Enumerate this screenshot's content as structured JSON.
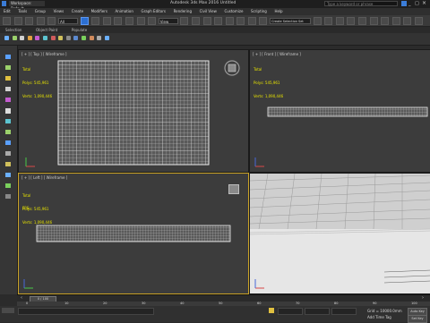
{
  "app": {
    "workspace": "Workspace: Default",
    "title": "Autodesk 3ds Max 2016    Untitled",
    "search_placeholder": "Type a keyword or phrase"
  },
  "menus": [
    "Edit",
    "Tools",
    "Group",
    "Views",
    "Create",
    "Modifiers",
    "Animation",
    "Graph Editors",
    "Rendering",
    "Civil View",
    "Customize",
    "Scripting",
    "Help"
  ],
  "toolbar": {
    "filter_value": "All",
    "view_value": "View",
    "selection_set": "Create Selection Set"
  },
  "ribbon": [
    "Selection",
    "Object Paint",
    "Populate"
  ],
  "viewports": {
    "top": {
      "label": "[ + ] [ Top ] [ Wireframe ]"
    },
    "front": {
      "label": "[ + ] [ Front ] [ Wireframe ]"
    },
    "left": {
      "label": "[ + ] [ Left ] [ Wireframe ]"
    },
    "persp": {
      "label": ""
    }
  },
  "stats": {
    "total": "Total",
    "polys_label": "Polys:",
    "polys": "545,961",
    "verts_label": "Verts:",
    "verts": "1,090,446",
    "fps": "FPS:"
  },
  "timeline": {
    "slider": "0 / 100",
    "ticks": [
      "0",
      "10",
      "20",
      "30",
      "40",
      "50",
      "60",
      "70",
      "80",
      "90",
      "100"
    ]
  },
  "status": {
    "grid": "Grid = 10000.0mm",
    "add_time_tag": "Add Time Tag",
    "auto_key": "Auto Key",
    "set_key": "Set Key"
  },
  "colors": {
    "accent_blue": "#2c6fd1",
    "active_border": "#c9a227",
    "stat_yellow": "#e6e200"
  }
}
